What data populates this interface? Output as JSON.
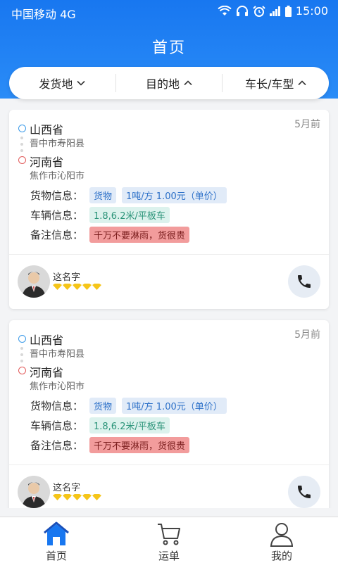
{
  "status": {
    "carrier": "中国移动 4G",
    "time": "15:00"
  },
  "header": {
    "title": "首页"
  },
  "filters": [
    {
      "label": "发货地",
      "icon": "chevron-down-icon"
    },
    {
      "label": "目的地",
      "icon": "chevron-up-icon"
    },
    {
      "label": "车长/车型",
      "icon": "chevron-up-icon"
    }
  ],
  "cards": [
    {
      "time": "5月前",
      "from_province": "山西省",
      "from_city": "晋中市寿阳县",
      "to_province": "河南省",
      "to_city": "焦作市沁阳市",
      "cargo_label": "货物信息：",
      "cargo_tags": [
        "货物",
        "1吨/方 1.00元（单价）"
      ],
      "vehicle_label": "车辆信息：",
      "vehicle_tag": "1.8,6.2米/平板车",
      "remark_label": "备注信息：",
      "remark_tag": "千万不要淋雨，货很贵",
      "user_name": "这名字",
      "rating": 5
    },
    {
      "time": "5月前",
      "from_province": "山西省",
      "from_city": "晋中市寿阳县",
      "to_province": "河南省",
      "to_city": "焦作市沁阳市",
      "cargo_label": "货物信息：",
      "cargo_tags": [
        "货物",
        "1吨/方 1.00元（单价）"
      ],
      "vehicle_label": "车辆信息：",
      "vehicle_tag": "1.8,6.2米/平板车",
      "remark_label": "备注信息：",
      "remark_tag": "千万不要淋雨，货很贵",
      "user_name": "这名字",
      "rating": 5
    }
  ],
  "tabbar": [
    {
      "label": "首页",
      "icon": "home-icon",
      "active": true
    },
    {
      "label": "运单",
      "icon": "cart-icon",
      "active": false
    },
    {
      "label": "我的",
      "icon": "user-icon",
      "active": false
    }
  ],
  "colors": {
    "primary": "#1877f0",
    "from_dot": "#3d9be9",
    "to_dot": "#e25c5c",
    "star": "#f5c518"
  }
}
